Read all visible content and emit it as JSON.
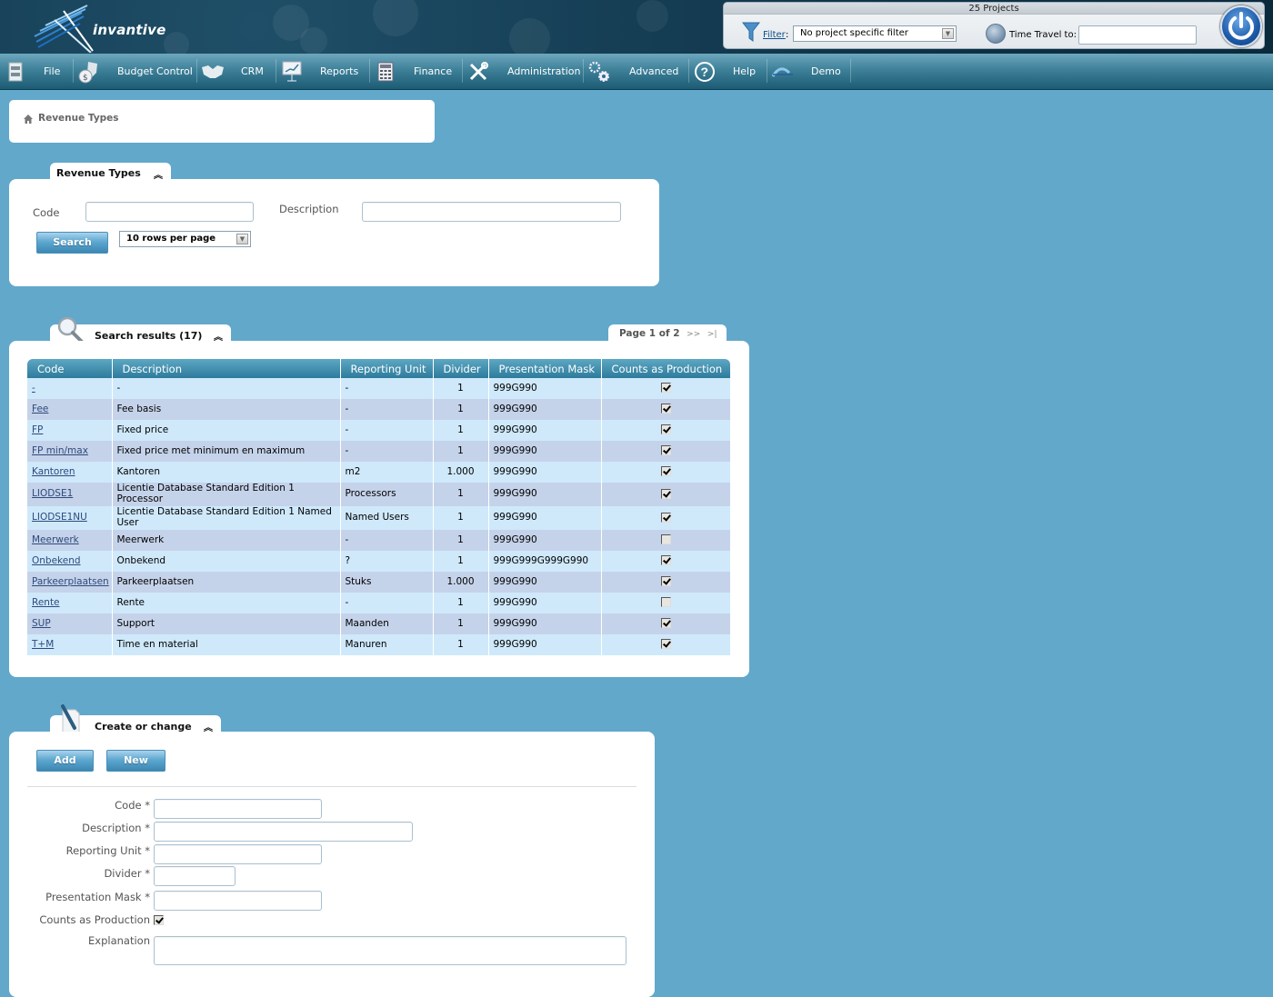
{
  "header": {
    "logo_text": "invantive",
    "projects_title": "25 Projects",
    "filter_link": "Filter",
    "filter_colon": ":",
    "filter_value": "No project specific filter",
    "time_travel_label": "Time Travel to:",
    "time_travel_value": ""
  },
  "menu": {
    "items": [
      {
        "label": "File",
        "icon": "file-cabinet-icon"
      },
      {
        "label": "Budget Control",
        "icon": "money-bag-shield-icon"
      },
      {
        "label": "CRM",
        "icon": "handshake-icon"
      },
      {
        "label": "Reports",
        "icon": "presentation-chart-icon"
      },
      {
        "label": "Finance",
        "icon": "calculator-icon"
      },
      {
        "label": "Administration",
        "icon": "tools-icon"
      },
      {
        "label": "Advanced",
        "icon": "gears-icon"
      },
      {
        "label": "Help",
        "icon": "question-icon"
      },
      {
        "label": "Demo",
        "icon": "demo-logo-icon"
      }
    ]
  },
  "breadcrumb": {
    "label": "Revenue Types"
  },
  "search_panel": {
    "tab_title": "Revenue Types",
    "collapse_glyph": "≈",
    "code_label": "Code",
    "code_value": "",
    "description_label": "Description",
    "description_value": "",
    "search_button": "Search",
    "rows_per_page": "10 rows per page"
  },
  "results_panel": {
    "tab_title": "Search results (17)",
    "pager_text": "Page 1 of 2",
    "pager_next": ">>",
    "pager_last": ">|",
    "columns": [
      "Code",
      "Description",
      "Reporting Unit",
      "Divider",
      "Presentation Mask",
      "Counts as Production"
    ],
    "rows": [
      {
        "code": "-",
        "description": "-",
        "unit": "-",
        "divider": "1",
        "mask": "999G990",
        "counts": true
      },
      {
        "code": "Fee",
        "description": "Fee basis",
        "unit": "-",
        "divider": "1",
        "mask": "999G990",
        "counts": true
      },
      {
        "code": "FP",
        "description": "Fixed price",
        "unit": "-",
        "divider": "1",
        "mask": "999G990",
        "counts": true
      },
      {
        "code": "FP min/max",
        "description": "Fixed price met minimum en maximum",
        "unit": "-",
        "divider": "1",
        "mask": "999G990",
        "counts": true
      },
      {
        "code": "Kantoren",
        "description": "Kantoren",
        "unit": "m2",
        "divider": "1.000",
        "mask": "999G990",
        "counts": true
      },
      {
        "code": "LIODSE1",
        "description": "Licentie Database Standard Edition 1 Processor",
        "unit": "Processors",
        "divider": "1",
        "mask": "999G990",
        "counts": true
      },
      {
        "code": "LIODSE1NU",
        "description": "Licentie Database Standard Edition 1 Named User",
        "unit": "Named Users",
        "divider": "1",
        "mask": "999G990",
        "counts": true
      },
      {
        "code": "Meerwerk",
        "description": "Meerwerk",
        "unit": "-",
        "divider": "1",
        "mask": "999G990",
        "counts": false
      },
      {
        "code": "Onbekend",
        "description": "Onbekend",
        "unit": "?",
        "divider": "1",
        "mask": "999G999G999G990",
        "counts": true
      },
      {
        "code": "Parkeerplaatsen",
        "description": "Parkeerplaatsen",
        "unit": "Stuks",
        "divider": "1.000",
        "mask": "999G990",
        "counts": true
      },
      {
        "code": "Rente",
        "description": "Rente",
        "unit": "-",
        "divider": "1",
        "mask": "999G990",
        "counts": false
      },
      {
        "code": "SUP",
        "description": "Support",
        "unit": "Maanden",
        "divider": "1",
        "mask": "999G990",
        "counts": true
      },
      {
        "code": "T+M",
        "description": "Time en material",
        "unit": "Manuren",
        "divider": "1",
        "mask": "999G990",
        "counts": true
      }
    ]
  },
  "edit_panel": {
    "tab_title": "Create or change",
    "add_button": "Add",
    "new_button": "New",
    "fields": {
      "code_label": "Code *",
      "code_value": "",
      "description_label": "Description *",
      "description_value": "",
      "unit_label": "Reporting Unit *",
      "unit_value": "",
      "divider_label": "Divider *",
      "divider_value": "",
      "mask_label": "Presentation Mask *",
      "mask_value": "",
      "counts_label": "Counts as Production",
      "counts_checked": true,
      "explanation_label": "Explanation",
      "explanation_value": ""
    }
  }
}
